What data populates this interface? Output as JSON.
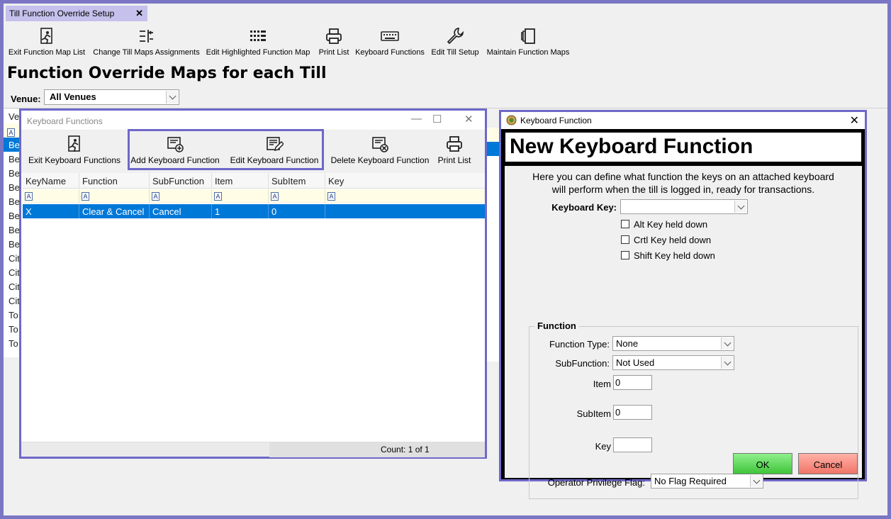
{
  "tab": {
    "title": "Till Function Override Setup",
    "close": "✕"
  },
  "ribbon": [
    {
      "label": "Exit Function Map List",
      "icon": "exit-icon"
    },
    {
      "label": "Change Till Maps Assignments",
      "icon": "assign-icon"
    },
    {
      "label": "Edit Highlighted Function Map",
      "icon": "grid-icon"
    },
    {
      "label": "Print List",
      "icon": "print-icon"
    },
    {
      "label": "Keyboard Functions",
      "icon": "keyboard-icon"
    },
    {
      "label": "Edit Till Setup",
      "icon": "wrench-icon"
    },
    {
      "label": "Maintain Function Maps",
      "icon": "pages-icon"
    }
  ],
  "page_title": "Function Override Maps for each Till",
  "venue": {
    "label": "Venue:",
    "value": "All Venues"
  },
  "bg_list": {
    "header": "Ve",
    "rows": [
      "Be",
      "Be",
      "Be",
      "Be",
      "Be",
      "Be",
      "Be",
      "Be",
      "Cit",
      "Cit",
      "Cit",
      "Cit",
      "To",
      "To",
      "To"
    ]
  },
  "kf_window": {
    "title": "Keyboard Functions",
    "toolbar": {
      "exit": "Exit Keyboard Functions",
      "add": "Add Keyboard Function",
      "edit": "Edit Keyboard Function",
      "delete": "Delete Keyboard Function",
      "print": "Print List"
    },
    "columns": [
      "KeyName",
      "Function",
      "SubFunction",
      "Item",
      "SubItem",
      "Key"
    ],
    "filter_icon": "A",
    "rows": [
      {
        "keyname": "X",
        "function": "Clear & Cancel",
        "subfunction": "Cancel",
        "item": "1",
        "subitem": "0",
        "key": ""
      }
    ],
    "count": "Count: 1 of 1"
  },
  "nk_window": {
    "titlebar": "Keyboard Function",
    "close": "✕",
    "heading": "New Keyboard Function",
    "description_line1": "Here you can define what function the keys on an attached keyboard",
    "description_line2": "will perform when the till is logged in, ready for transactions.",
    "keyboard_key_label": "Keyboard Key:",
    "keyboard_key_value": "",
    "alt_label": "Alt Key held down",
    "ctrl_label": "Crtl Key held down",
    "shift_label": "Shift Key held down",
    "function_group": "Function",
    "function_type_label": "Function Type:",
    "function_type_value": "None",
    "subfunction_label": "SubFunction:",
    "subfunction_value": "Not Used",
    "item_label": "Item",
    "item_value": "0",
    "subitem_label": "SubItem",
    "subitem_value": "0",
    "key_label": "Key",
    "key_value": "",
    "privilege_label": "Operator Privilege Flag:",
    "privilege_value": "No Flag Required",
    "ok": "OK",
    "cancel": "Cancel"
  },
  "colors": {
    "accent_border": "#6e68c9",
    "selection": "#0078d7",
    "tab": "#c5c1ec",
    "ok": "#4fcf4a",
    "cancel": "#f48a7e"
  }
}
